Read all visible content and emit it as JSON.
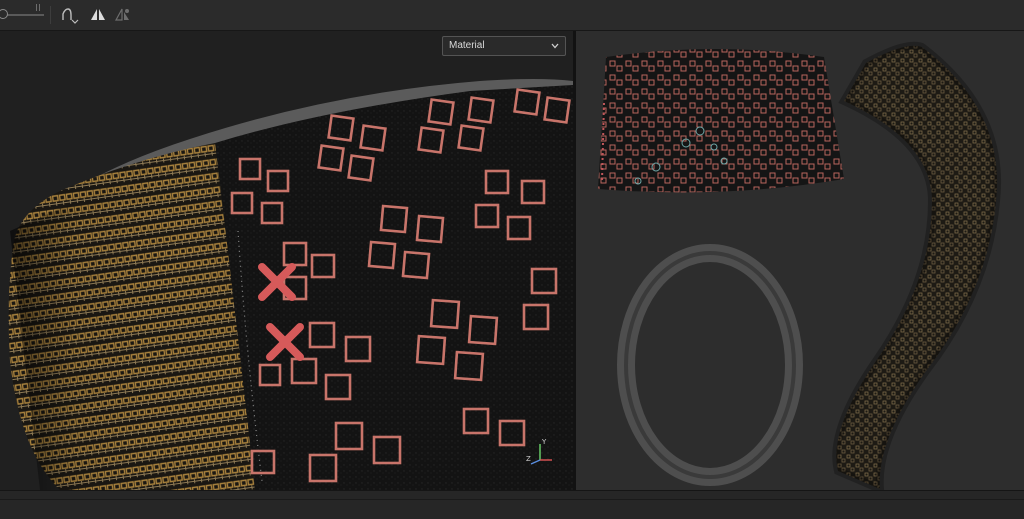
{
  "toolbar": {
    "slider_value": 0.0,
    "tools": [
      {
        "name": "curve-tool-icon"
      },
      {
        "name": "mirror-icon"
      },
      {
        "name": "mirror-alt-icon"
      }
    ]
  },
  "viewport3d": {
    "display_mode": {
      "selected": "Material"
    },
    "axis_gizmo": {
      "x_label": "X",
      "y_label": "Y",
      "z_label": "Z"
    }
  },
  "viewport2d": {
    "uv_islands": [
      "top-panel",
      "side-strip",
      "ring-rim"
    ]
  },
  "colors": {
    "fabric_dark": "#161616",
    "pattern_red": "#c86a5e",
    "pattern_gold": "#b08a3e",
    "rim_gray": "#5c5c5c",
    "accent_x": "#d14f4f"
  }
}
